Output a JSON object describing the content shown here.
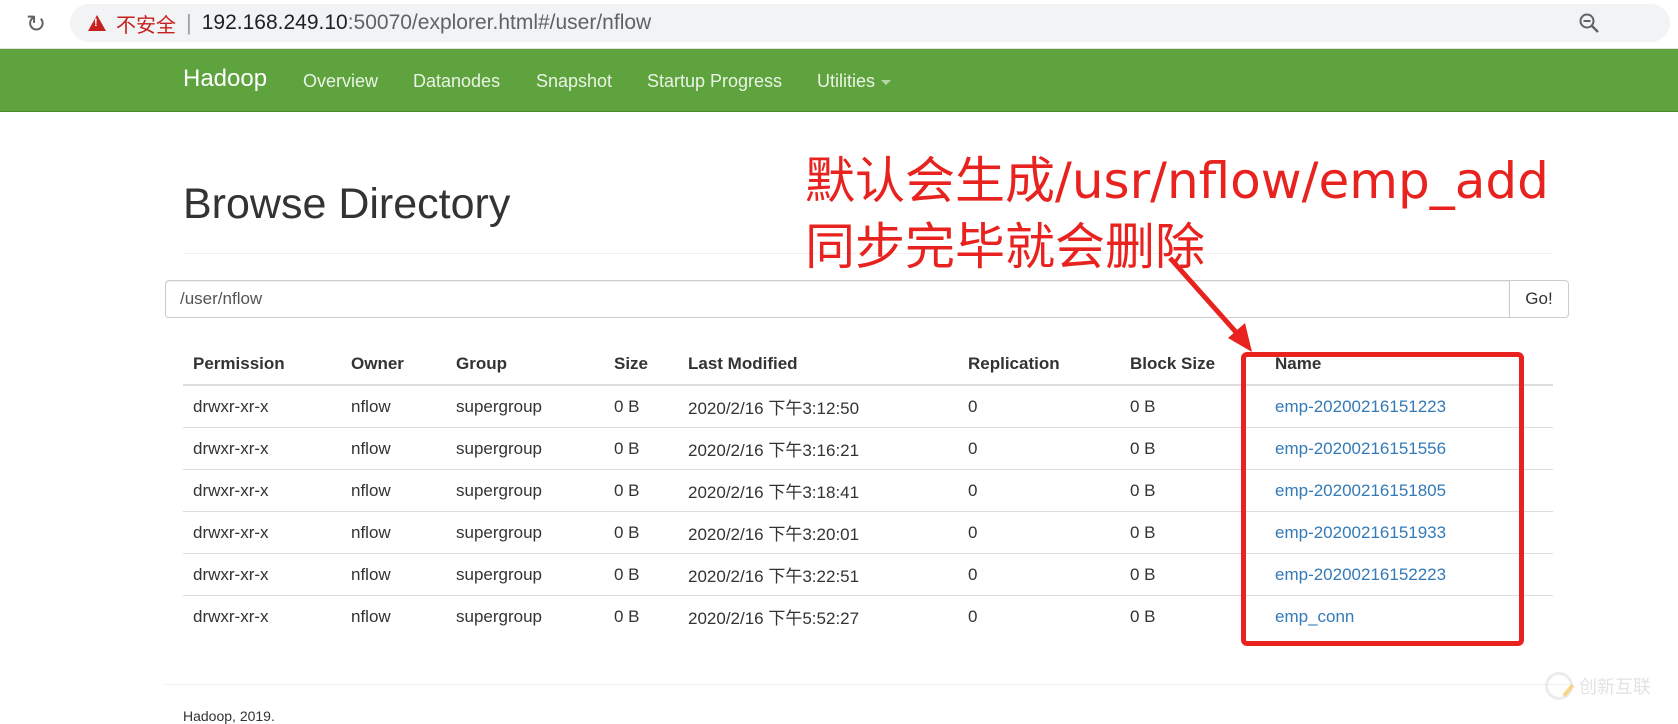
{
  "browser": {
    "reload_icon": "reload-icon",
    "security_label": "不安全",
    "url_host": "192.168.249.10",
    "url_rest": ":50070/explorer.html#/user/nflow",
    "zoom_icon": "zoom-out-icon"
  },
  "navbar": {
    "brand": "Hadoop",
    "items": [
      {
        "label": "Overview"
      },
      {
        "label": "Datanodes"
      },
      {
        "label": "Snapshot"
      },
      {
        "label": "Startup Progress"
      },
      {
        "label": "Utilities"
      }
    ],
    "color": "#5fa33e"
  },
  "page": {
    "title": "Browse Directory",
    "path_value": "/user/nflow",
    "go_label": "Go!"
  },
  "table": {
    "columns": [
      "Permission",
      "Owner",
      "Group",
      "Size",
      "Last Modified",
      "Replication",
      "Block Size",
      "Name"
    ],
    "rows": [
      {
        "permission": "drwxr-xr-x",
        "owner": "nflow",
        "group": "supergroup",
        "size": "0 B",
        "modified": "2020/2/16 下午3:12:50",
        "replication": "0",
        "block_size": "0 B",
        "name": "emp-20200216151223"
      },
      {
        "permission": "drwxr-xr-x",
        "owner": "nflow",
        "group": "supergroup",
        "size": "0 B",
        "modified": "2020/2/16 下午3:16:21",
        "replication": "0",
        "block_size": "0 B",
        "name": "emp-20200216151556"
      },
      {
        "permission": "drwxr-xr-x",
        "owner": "nflow",
        "group": "supergroup",
        "size": "0 B",
        "modified": "2020/2/16 下午3:18:41",
        "replication": "0",
        "block_size": "0 B",
        "name": "emp-20200216151805"
      },
      {
        "permission": "drwxr-xr-x",
        "owner": "nflow",
        "group": "supergroup",
        "size": "0 B",
        "modified": "2020/2/16 下午3:20:01",
        "replication": "0",
        "block_size": "0 B",
        "name": "emp-20200216151933"
      },
      {
        "permission": "drwxr-xr-x",
        "owner": "nflow",
        "group": "supergroup",
        "size": "0 B",
        "modified": "2020/2/16 下午3:22:51",
        "replication": "0",
        "block_size": "0 B",
        "name": "emp-20200216152223"
      },
      {
        "permission": "drwxr-xr-x",
        "owner": "nflow",
        "group": "supergroup",
        "size": "0 B",
        "modified": "2020/2/16 下午5:52:27",
        "replication": "0",
        "block_size": "0 B",
        "name": "emp_conn"
      }
    ]
  },
  "footer": {
    "text": "Hadoop, 2019."
  },
  "annotation": {
    "line1": "默认会生成/usr/nflow/emp_add",
    "line2": "同步完毕就会删除",
    "color": "#e8231f"
  },
  "watermark": {
    "text": "创新互联"
  }
}
